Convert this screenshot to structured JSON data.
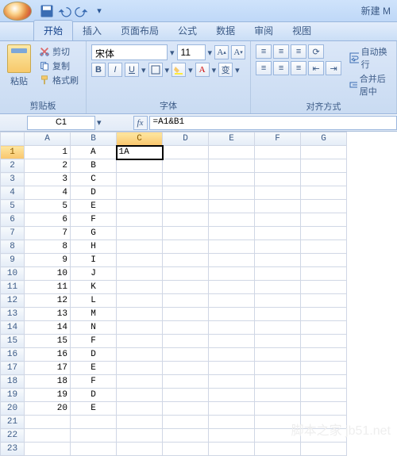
{
  "title": "新建 M",
  "tabs": [
    "开始",
    "插入",
    "页面布局",
    "公式",
    "数据",
    "审阅",
    "视图"
  ],
  "activeTab": 0,
  "clipboard": {
    "paste": "粘贴",
    "cut": "剪切",
    "copy": "复制",
    "painter": "格式刷",
    "label": "剪贴板"
  },
  "font": {
    "name": "宋体",
    "size": "11",
    "label": "字体"
  },
  "align": {
    "wrap": "自动换行",
    "merge": "合并后居中",
    "label": "对齐方式"
  },
  "namebox": "C1",
  "fx": "fx",
  "formula": "=A1&B1",
  "cols": [
    "A",
    "B",
    "C",
    "D",
    "E",
    "F",
    "G"
  ],
  "activeCol": 2,
  "activeRow": 0,
  "rows": [
    {
      "n": 1,
      "a": "1",
      "b": "A",
      "c": "1A"
    },
    {
      "n": 2,
      "a": "2",
      "b": "B"
    },
    {
      "n": 3,
      "a": "3",
      "b": "C"
    },
    {
      "n": 4,
      "a": "4",
      "b": "D"
    },
    {
      "n": 5,
      "a": "5",
      "b": "E"
    },
    {
      "n": 6,
      "a": "6",
      "b": "F"
    },
    {
      "n": 7,
      "a": "7",
      "b": "G"
    },
    {
      "n": 8,
      "a": "8",
      "b": "H"
    },
    {
      "n": 9,
      "a": "9",
      "b": "I"
    },
    {
      "n": 10,
      "a": "10",
      "b": "J"
    },
    {
      "n": 11,
      "a": "11",
      "b": "K"
    },
    {
      "n": 12,
      "a": "12",
      "b": "L"
    },
    {
      "n": 13,
      "a": "13",
      "b": "M"
    },
    {
      "n": 14,
      "a": "14",
      "b": "N"
    },
    {
      "n": 15,
      "a": "15",
      "b": "F"
    },
    {
      "n": 16,
      "a": "16",
      "b": "D"
    },
    {
      "n": 17,
      "a": "17",
      "b": "E"
    },
    {
      "n": 18,
      "a": "18",
      "b": "F"
    },
    {
      "n": 19,
      "a": "19",
      "b": "D"
    },
    {
      "n": 20,
      "a": "20",
      "b": "E"
    },
    {
      "n": 21
    },
    {
      "n": 22
    },
    {
      "n": 23
    }
  ],
  "watermark": "脚本之家 jb51.net"
}
